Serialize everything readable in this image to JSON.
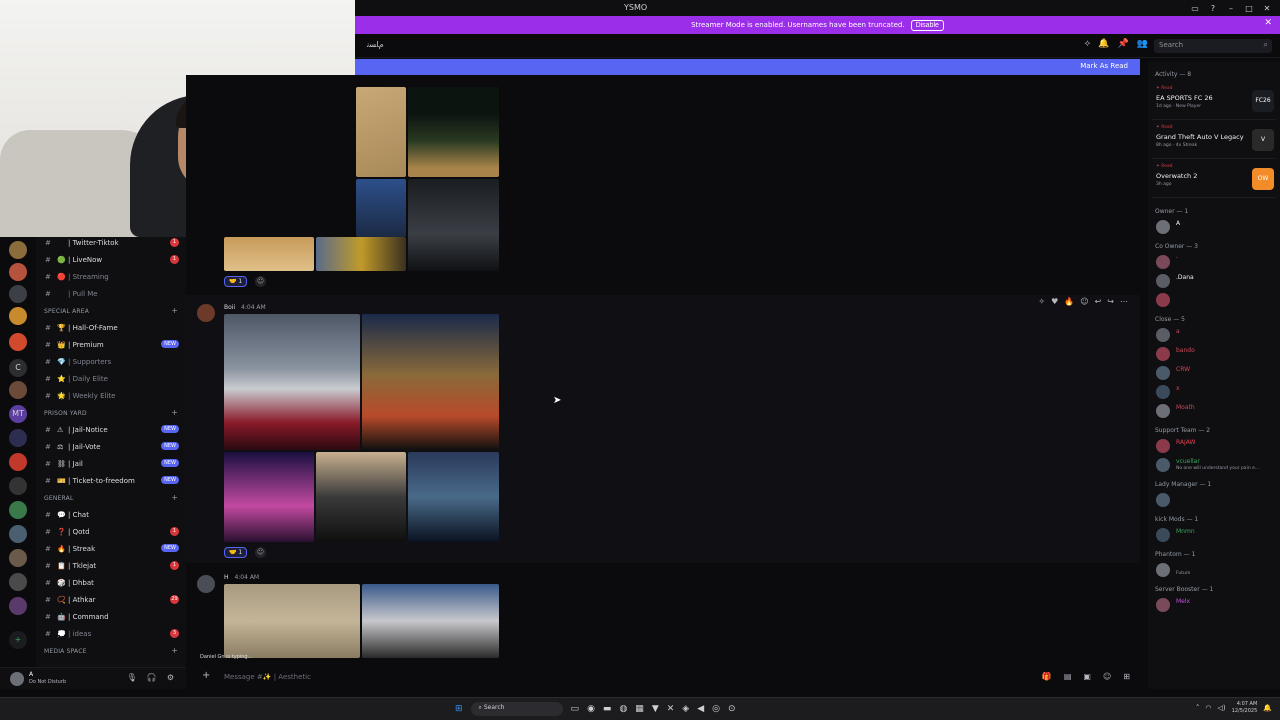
{
  "app": {
    "title": "YSMO"
  },
  "window_controls": [
    "restore",
    "help",
    "minimize",
    "maximize",
    "close"
  ],
  "streamer_bar": {
    "message": "Streamer Mode is enabled. Usernames have been truncated.",
    "button": "Disable",
    "close": "✕"
  },
  "topbar": {
    "server_glyph": "ﻡﺎﺴﻧ",
    "search_placeholder": "Search"
  },
  "new_messages": {
    "mark_read": "Mark As Read"
  },
  "servers": [
    "A",
    "C",
    "MT"
  ],
  "channels": [
    {
      "name": "| Twitter-Tiktok",
      "emoji": "",
      "muted": false,
      "badge": "1"
    },
    {
      "name": "| LiveNow",
      "emoji": "🟢",
      "muted": false,
      "badge": "1"
    },
    {
      "name": "| Streaming",
      "emoji": "🔴",
      "muted": true,
      "badge": ""
    },
    {
      "name": "| Pull Me",
      "emoji": "",
      "muted": true,
      "badge": ""
    },
    {
      "category": "SPECIAL AREA"
    },
    {
      "name": "| Hall-Of-Fame",
      "emoji": "🏆",
      "muted": false,
      "badge": ""
    },
    {
      "name": "| Premium",
      "emoji": "👑",
      "muted": false,
      "badge": "NEW"
    },
    {
      "name": "| Supporters",
      "emoji": "💎",
      "muted": true,
      "badge": ""
    },
    {
      "name": "| Daily Elite",
      "emoji": "⭐",
      "muted": true,
      "badge": ""
    },
    {
      "name": "| Weekly Elite",
      "emoji": "🌟",
      "muted": true,
      "badge": ""
    },
    {
      "category": "PRISON YARD"
    },
    {
      "name": "| Jail-Notice",
      "emoji": "⚠",
      "muted": false,
      "badge": "NEW"
    },
    {
      "name": "| Jail-Vote",
      "emoji": "⚖",
      "muted": false,
      "badge": "NEW"
    },
    {
      "name": "| Jail",
      "emoji": "⛓",
      "muted": false,
      "badge": "NEW"
    },
    {
      "name": "| Ticket-to-freedom",
      "emoji": "🎫",
      "muted": false,
      "badge": "NEW"
    },
    {
      "category": "GENERAL"
    },
    {
      "name": "| Chat",
      "emoji": "💬",
      "muted": false,
      "badge": ""
    },
    {
      "name": "| Qotd",
      "emoji": "❓",
      "muted": false,
      "badge": "1"
    },
    {
      "name": "| Streak",
      "emoji": "🔥",
      "muted": false,
      "badge": "NEW"
    },
    {
      "name": "| Tklejat",
      "emoji": "📋",
      "muted": false,
      "badge": "1"
    },
    {
      "name": "| Dhbat",
      "emoji": "🎲",
      "muted": false,
      "badge": ""
    },
    {
      "name": "| Athkar",
      "emoji": "📿",
      "muted": false,
      "badge": "29"
    },
    {
      "name": "| Command",
      "emoji": "🤖",
      "muted": false,
      "badge": ""
    },
    {
      "name": "| ideas",
      "emoji": "💭",
      "muted": true,
      "badge": "3"
    },
    {
      "category": "MEDIA SPACE"
    }
  ],
  "user_panel": {
    "name": "A",
    "status": "Do Not Disturb"
  },
  "messages": [
    {
      "author": "Boii",
      "time": "4:04 AM",
      "reaction_count": "1"
    },
    {
      "author": "H",
      "time": "4:04 AM"
    }
  ],
  "first_reaction_count": "1",
  "typing": "Daniel Gn is typing...",
  "composer": {
    "placeholder": "Message #✨ | Aesthetic"
  },
  "members": {
    "activity_header": "Activity — 8",
    "activities": [
      {
        "tag": "✦ Read",
        "game": "EA SPORTS FC 26",
        "meta": "1d ago · New Player",
        "icon": "FC26"
      },
      {
        "tag": "✦ Read",
        "game": "Grand Theft Auto V Legacy",
        "meta": "8h ago · 4x Streak",
        "icon": "V"
      },
      {
        "tag": "✦ Read",
        "game": "Overwatch 2",
        "meta": "3h ago",
        "icon": "OW"
      }
    ],
    "sections": [
      {
        "title": "Owner — 1",
        "people": [
          {
            "name": "A",
            "color": "#f2f3f5",
            "sub": ""
          }
        ]
      },
      {
        "title": "Co Owner — 3",
        "people": [
          {
            "name": "·",
            "color": "#e06c9f",
            "sub": ""
          },
          {
            "name": ".Dana",
            "color": "#f2f3f5",
            "sub": ""
          },
          {
            "name": "",
            "color": "#c44fe0",
            "sub": ""
          }
        ]
      },
      {
        "title": "Close — 5",
        "people": [
          {
            "name": "a",
            "color": "#c94a5a",
            "sub": ""
          },
          {
            "name": "bando",
            "color": "#c94a5a",
            "sub": ""
          },
          {
            "name": "CRW",
            "color": "#c94a5a",
            "sub": ""
          },
          {
            "name": "x",
            "color": "#c94a5a",
            "sub": ""
          },
          {
            "name": "Moath",
            "color": "#c94a5a",
            "sub": ""
          }
        ]
      },
      {
        "title": "Support Team — 2",
        "people": [
          {
            "name": "RAJAW",
            "color": "#e0414f",
            "sub": ""
          },
          {
            "name": "vcuellar",
            "color": "#3ba55d",
            "sub": "No one will understand your pain e..."
          }
        ]
      },
      {
        "title": "Lady Manager — 1",
        "people": [
          {
            "name": "",
            "color": "#b58ad6",
            "sub": ""
          }
        ]
      },
      {
        "title": "kick Mods — 1",
        "people": [
          {
            "name": "Mnmn",
            "color": "#3ba55d",
            "sub": ""
          }
        ]
      },
      {
        "title": "Phantom — 1",
        "people": [
          {
            "name": "",
            "color": "#5865f2",
            "sub": "Future"
          }
        ]
      },
      {
        "title": "Server Booster — 1",
        "people": [
          {
            "name": "Melx",
            "color": "#c44fe0",
            "sub": ""
          }
        ]
      }
    ]
  },
  "taskbar": {
    "search": "Search",
    "time": "4:07 AM",
    "date": "12/5/2025"
  }
}
